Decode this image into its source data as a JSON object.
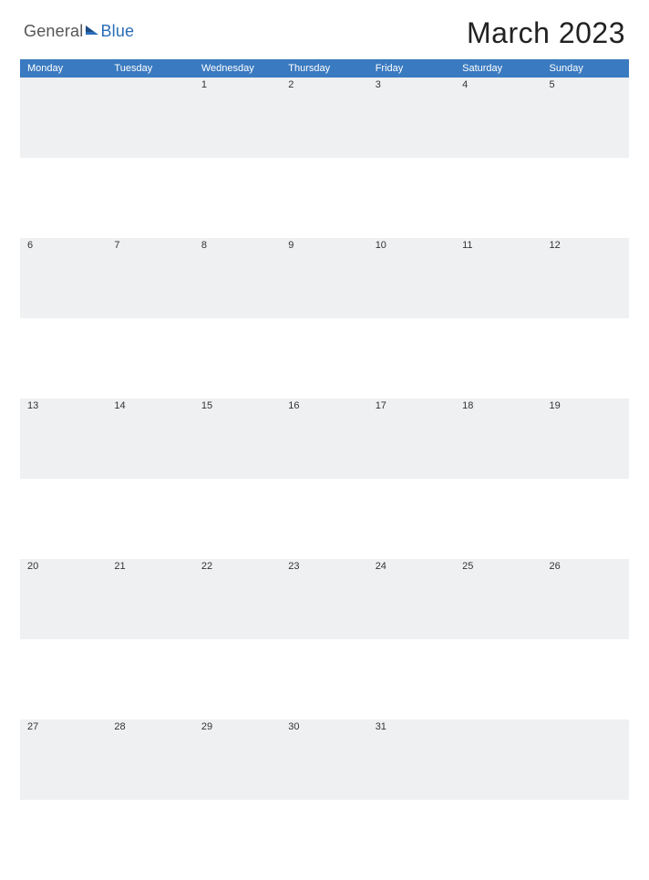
{
  "brand": {
    "part1": "General",
    "part2": "Blue"
  },
  "title": "March 2023",
  "accent": "#3a7ac0",
  "days": [
    "Monday",
    "Tuesday",
    "Wednesday",
    "Thursday",
    "Friday",
    "Saturday",
    "Sunday"
  ],
  "weeks": [
    [
      "",
      "",
      "1",
      "2",
      "3",
      "4",
      "5"
    ],
    [
      "6",
      "7",
      "8",
      "9",
      "10",
      "11",
      "12"
    ],
    [
      "13",
      "14",
      "15",
      "16",
      "17",
      "18",
      "19"
    ],
    [
      "20",
      "21",
      "22",
      "23",
      "24",
      "25",
      "26"
    ],
    [
      "27",
      "28",
      "29",
      "30",
      "31",
      "",
      ""
    ]
  ]
}
